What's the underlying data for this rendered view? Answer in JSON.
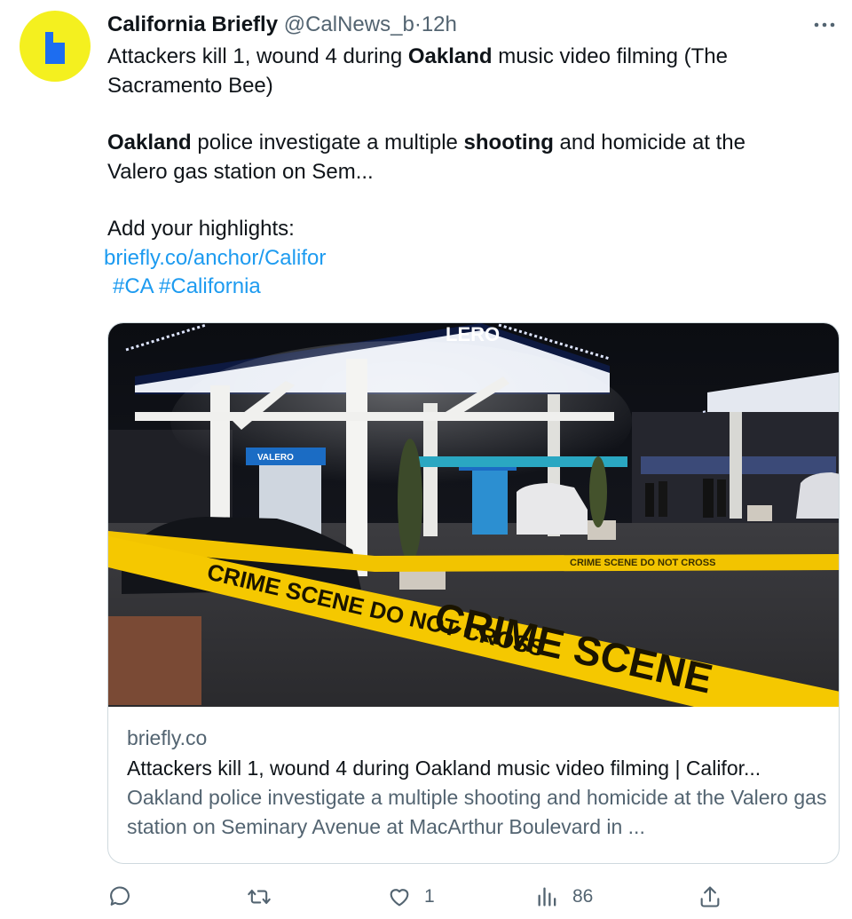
{
  "tweet": {
    "author_name": "California Briefly",
    "author_handle": "@CalNews_b",
    "separator": "·",
    "time": "12h",
    "line1_before": "Attackers kill 1, wound 4 during ",
    "line1_bold": "Oakland",
    "line1_after": " music video filming (The Sacramento Bee)",
    "line2_bold1": "Oakland",
    "line2_mid": " police investigate a multiple ",
    "line2_bold2": "shooting",
    "line2_after": " and homicide at the Valero gas station on Sem...",
    "highlights_label": "Add your highlights:",
    "link": "briefly.co/anchor/Califor",
    "hashtags": "#CA #California"
  },
  "card": {
    "domain": "briefly.co",
    "title": "Attackers kill 1, wound 4 during Oakland music video filming | Califor...",
    "description": "Oakland police investigate a multiple shooting and homicide at the Valero gas station on Seminary Avenue at MacArthur Boulevard in ...",
    "image": {
      "sign_text": "LERO",
      "pump_label": "VALERO",
      "tape_text": "CRIME SCENE DO NOT CROSS",
      "tape_text_big": "CRIME SCENE"
    }
  },
  "actions": {
    "reply_icon": "reply-icon",
    "retweet_icon": "retweet-icon",
    "like_icon": "heart-icon",
    "like_count": "1",
    "views_icon": "views-icon",
    "views_count": "86",
    "share_icon": "share-icon"
  },
  "colors": {
    "avatar_bg": "#f4f01f",
    "avatar_mark": "#1d6df0",
    "link": "#1d9bf0",
    "secondary": "#536471",
    "tape": "#f2c400"
  }
}
